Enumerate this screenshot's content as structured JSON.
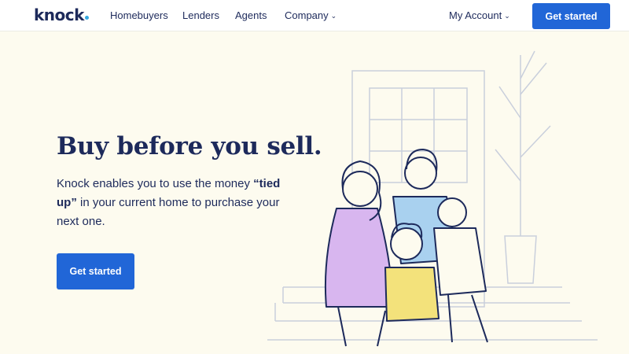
{
  "nav": {
    "logo": "knock",
    "links": [
      "Homebuyers",
      "Lenders",
      "Agents",
      "Company"
    ],
    "account": "My Account",
    "cta": "Get started"
  },
  "hero": {
    "title": "Buy before you sell.",
    "text_before": "Knock enables you to use the money ",
    "text_bold": "“tied up”",
    "text_after": " in your current home to purchase your next one.",
    "cta": "Get started"
  },
  "colors": {
    "background": "#fdfbef",
    "navy": "#1d2a5b",
    "accent": "#2166d7",
    "logo_dot": "#36a9e1"
  },
  "illustration": {
    "icon": "family-on-porch-illustration"
  }
}
